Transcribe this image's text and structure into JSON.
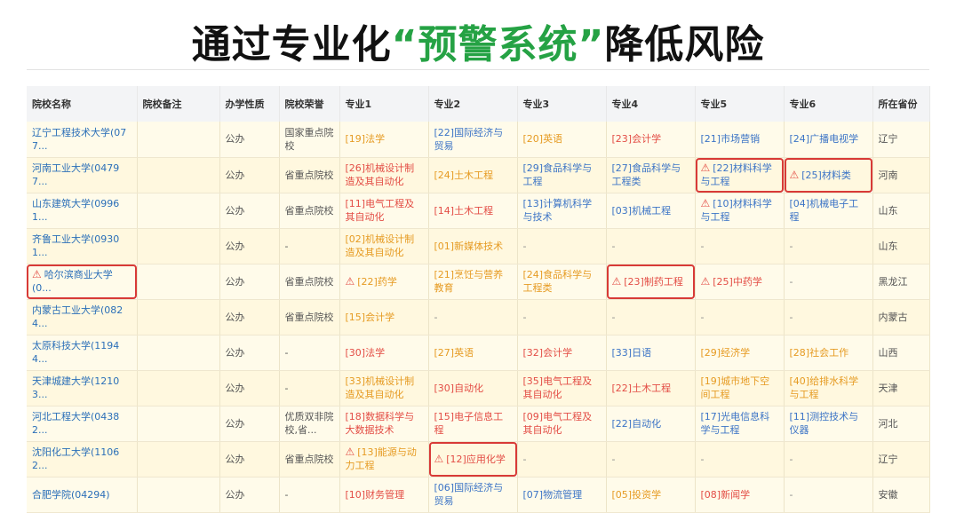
{
  "headline": {
    "before": "通过专业化",
    "highlight": "“预警系统”",
    "after": "降低风险"
  },
  "colors": {
    "headline_green": "#25a244",
    "warning_red": "#e34d45",
    "orange": "#e69b23",
    "blue": "#3c74c6",
    "flag_border": "#d83a37"
  },
  "table": {
    "headers": [
      "院校名称",
      "院校备注",
      "办学性质",
      "院校荣誉",
      "专业1",
      "专业2",
      "专业3",
      "专业4",
      "专业5",
      "专业6",
      "所在省份"
    ],
    "rows": [
      {
        "name": "辽宁工程技术大学(077...",
        "warn": false,
        "flag": false,
        "note": "",
        "nature": "公办",
        "honor": "国家重点院校",
        "majors": [
          {
            "text": "[19]法学",
            "color": "orange"
          },
          {
            "text": "[22]国际经济与贸易",
            "color": "blue"
          },
          {
            "text": "[20]英语",
            "color": "orange"
          },
          {
            "text": "[23]会计学",
            "color": "red"
          },
          {
            "text": "[21]市场营销",
            "color": "blue"
          },
          {
            "text": "[24]广播电视学",
            "color": "blue"
          }
        ],
        "province": "辽宁"
      },
      {
        "name": "河南工业大学(04797...",
        "warn": false,
        "flag": false,
        "note": "",
        "nature": "公办",
        "honor": "省重点院校",
        "majors": [
          {
            "text": "[26]机械设计制造及其自动化",
            "color": "red"
          },
          {
            "text": "[24]土木工程",
            "color": "orange"
          },
          {
            "text": "[29]食品科学与工程",
            "color": "blue"
          },
          {
            "text": "[27]食品科学与工程类",
            "color": "blue"
          },
          {
            "text": "[22]材料科学与工程",
            "color": "blue",
            "warn": true,
            "flag": true
          },
          {
            "text": "[25]材料类",
            "color": "blue",
            "warn": true,
            "flag": true
          }
        ],
        "province": "河南"
      },
      {
        "name": "山东建筑大学(09961...",
        "warn": false,
        "flag": false,
        "note": "",
        "nature": "公办",
        "honor": "省重点院校",
        "majors": [
          {
            "text": "[11]电气工程及其自动化",
            "color": "red"
          },
          {
            "text": "[14]土木工程",
            "color": "red"
          },
          {
            "text": "[13]计算机科学与技术",
            "color": "blue"
          },
          {
            "text": "[03]机械工程",
            "color": "blue"
          },
          {
            "text": "[10]材料科学与工程",
            "color": "blue",
            "warn": true
          },
          {
            "text": "[04]机械电子工程",
            "color": "blue"
          }
        ],
        "province": "山东"
      },
      {
        "name": "齐鲁工业大学(09301...",
        "warn": false,
        "flag": false,
        "note": "",
        "nature": "公办",
        "honor": "-",
        "majors": [
          {
            "text": "[02]机械设计制造及其自动化",
            "color": "orange"
          },
          {
            "text": "[01]新媒体技术",
            "color": "orange"
          },
          {
            "text": "-",
            "color": "gray"
          },
          {
            "text": "-",
            "color": "gray"
          },
          {
            "text": "-",
            "color": "gray"
          },
          {
            "text": "-",
            "color": "gray"
          }
        ],
        "province": "山东"
      },
      {
        "name": "哈尔滨商业大学(0...",
        "warn": true,
        "flag": true,
        "note": "",
        "nature": "公办",
        "honor": "省重点院校",
        "majors": [
          {
            "text": "[22]药学",
            "color": "orange",
            "warn": true
          },
          {
            "text": "[21]烹饪与营养教育",
            "color": "orange"
          },
          {
            "text": "[24]食品科学与工程类",
            "color": "orange"
          },
          {
            "text": "[23]制药工程",
            "color": "red",
            "warn": true,
            "flag": true
          },
          {
            "text": "[25]中药学",
            "color": "red",
            "warn": true
          },
          {
            "text": "-",
            "color": "gray"
          }
        ],
        "province": "黑龙江"
      },
      {
        "name": "内蒙古工业大学(0824...",
        "warn": false,
        "flag": false,
        "note": "",
        "nature": "公办",
        "honor": "省重点院校",
        "majors": [
          {
            "text": "[15]会计学",
            "color": "orange"
          },
          {
            "text": "-",
            "color": "gray"
          },
          {
            "text": "-",
            "color": "gray"
          },
          {
            "text": "-",
            "color": "gray"
          },
          {
            "text": "-",
            "color": "gray"
          },
          {
            "text": "-",
            "color": "gray"
          }
        ],
        "province": "内蒙古"
      },
      {
        "name": "太原科技大学(11944...",
        "warn": false,
        "flag": false,
        "note": "",
        "nature": "公办",
        "honor": "-",
        "majors": [
          {
            "text": "[30]法学",
            "color": "red"
          },
          {
            "text": "[27]英语",
            "color": "orange"
          },
          {
            "text": "[32]会计学",
            "color": "red"
          },
          {
            "text": "[33]日语",
            "color": "blue"
          },
          {
            "text": "[29]经济学",
            "color": "orange"
          },
          {
            "text": "[28]社会工作",
            "color": "orange"
          }
        ],
        "province": "山西"
      },
      {
        "name": "天津城建大学(12103...",
        "warn": false,
        "flag": false,
        "note": "",
        "nature": "公办",
        "honor": "-",
        "majors": [
          {
            "text": "[33]机械设计制造及其自动化",
            "color": "orange"
          },
          {
            "text": "[30]自动化",
            "color": "red"
          },
          {
            "text": "[35]电气工程及其自动化",
            "color": "red"
          },
          {
            "text": "[22]土木工程",
            "color": "red"
          },
          {
            "text": "[19]城市地下空间工程",
            "color": "orange"
          },
          {
            "text": "[40]给排水科学与工程",
            "color": "orange"
          }
        ],
        "province": "天津"
      },
      {
        "name": "河北工程大学(04382...",
        "warn": false,
        "flag": false,
        "note": "",
        "nature": "公办",
        "honor": "优质双非院校,省...",
        "majors": [
          {
            "text": "[18]数据科学与大数据技术",
            "color": "red"
          },
          {
            "text": "[15]电子信息工程",
            "color": "red"
          },
          {
            "text": "[09]电气工程及其自动化",
            "color": "red"
          },
          {
            "text": "[22]自动化",
            "color": "blue"
          },
          {
            "text": "[17]光电信息科学与工程",
            "color": "blue"
          },
          {
            "text": "[11]测控技术与仪器",
            "color": "blue"
          }
        ],
        "province": "河北"
      },
      {
        "name": "沈阳化工大学(11062...",
        "warn": false,
        "flag": false,
        "note": "",
        "nature": "公办",
        "honor": "省重点院校",
        "majors": [
          {
            "text": "[13]能源与动力工程",
            "color": "orange",
            "warn": true
          },
          {
            "text": "[12]应用化学",
            "color": "red",
            "warn": true,
            "flag": true
          },
          {
            "text": "-",
            "color": "gray"
          },
          {
            "text": "-",
            "color": "gray"
          },
          {
            "text": "-",
            "color": "gray"
          },
          {
            "text": "-",
            "color": "gray"
          }
        ],
        "province": "辽宁"
      },
      {
        "name": "合肥学院(04294)",
        "warn": false,
        "flag": false,
        "note": "",
        "nature": "公办",
        "honor": "-",
        "majors": [
          {
            "text": "[10]财务管理",
            "color": "red"
          },
          {
            "text": "[06]国际经济与贸易",
            "color": "blue"
          },
          {
            "text": "[07]物流管理",
            "color": "blue"
          },
          {
            "text": "[05]投资学",
            "color": "orange"
          },
          {
            "text": "[08]新闻学",
            "color": "red"
          },
          {
            "text": "-",
            "color": "gray"
          }
        ],
        "province": "安徽"
      }
    ]
  }
}
